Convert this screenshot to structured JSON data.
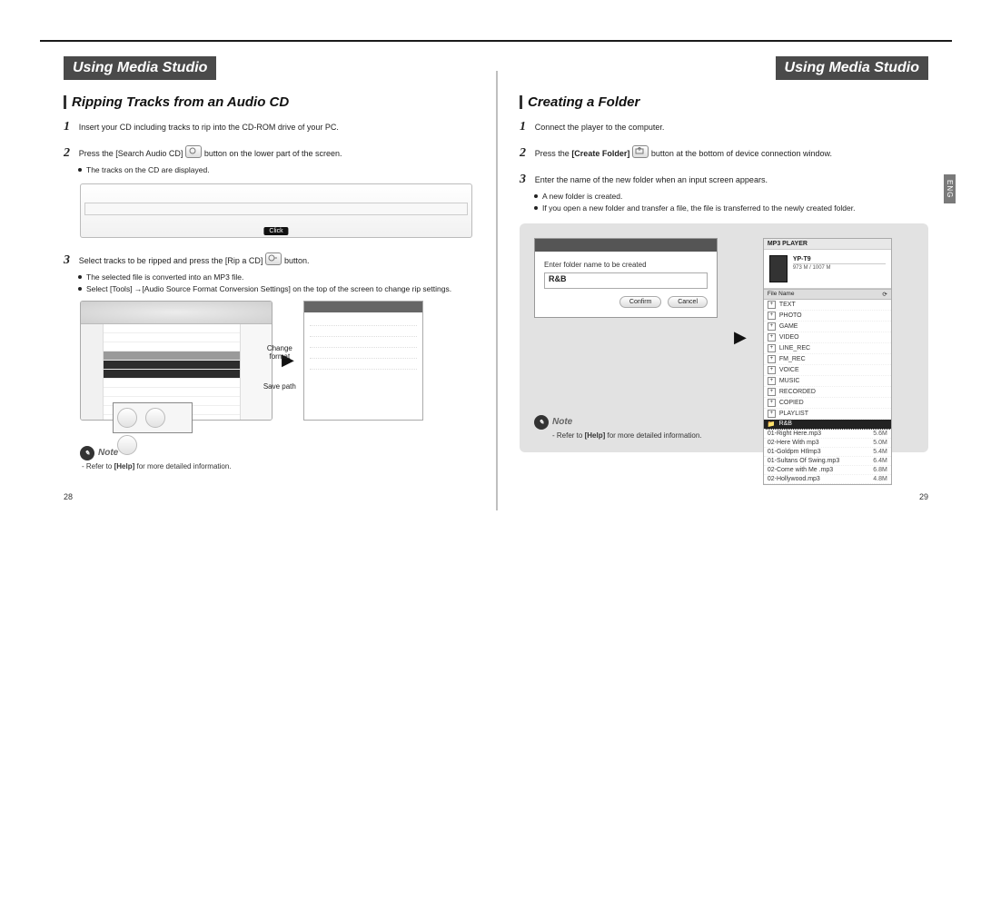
{
  "doc": {
    "lang_tab": "ENG",
    "header_title": "Using Media Studio",
    "left": {
      "page": "28",
      "subtitle": "Ripping Tracks from an Audio CD",
      "step1": "Insert your CD including tracks to rip into the CD-ROM drive of your PC.",
      "step2_pre": "Press the [Search Audio CD]",
      "step2_post": "button on the lower part of the screen.",
      "step2_b1": "The tracks on the CD are displayed.",
      "fig1_click": "Click",
      "step3_pre": "Select tracks to be ripped and press the [Rip a CD]",
      "step3_post": "button.",
      "step3_b1": "The selected file is converted into an MP3 file.",
      "step3_b2": "Select [Tools] →[Audio Source Format Conversion Settings] on the top of the screen to change rip settings.",
      "ann_change": "Change format",
      "ann_save": "Save path",
      "note_label": "Note",
      "note_text_pre": "- Refer to ",
      "note_text_bold": "[Help]",
      "note_text_post": " for more detailed information."
    },
    "right": {
      "page": "29",
      "subtitle": "Creating a Folder",
      "step1": "Connect the player to the computer.",
      "step2_pre": "Press the ",
      "step2_bold": "[Create Folder]",
      "step2_post": " button at the bottom of device connection window.",
      "step3": "Enter the name of the new folder when an input screen appears.",
      "step3_b1": "A new folder is created.",
      "step3_b2": "If you open a new folder and transfer a file, the file is transferred to the newly created folder.",
      "dialog": {
        "label": "Enter folder name to be created",
        "input": "R&B",
        "confirm": "Confirm",
        "cancel": "Cancel"
      },
      "tree": {
        "title": "MP3 PLAYER",
        "device": "YP-T9",
        "capacity": "973 M / 1007 M",
        "col_file": "File Name",
        "folders": [
          "TEXT",
          "PHOTO",
          "GAME",
          "VIDEO",
          "LINE_REC",
          "FM_REC",
          "VOICE",
          "MUSIC",
          "RECORDED",
          "COPIED",
          "PLAYLIST"
        ],
        "selected_folder": "R&B",
        "files": [
          {
            "n": "01-Right Here.mp3",
            "s": "5.6M"
          },
          {
            "n": "02-Here With mp3",
            "s": "5.0M"
          },
          {
            "n": "01-Goldpm HIlmp3",
            "s": "5.4M"
          },
          {
            "n": "01-Sultans Of Swing.mp3",
            "s": "6.4M"
          },
          {
            "n": "02-Come with Me .mp3",
            "s": "6.8M"
          },
          {
            "n": "02-Hollywood.mp3",
            "s": "4.8M"
          }
        ]
      },
      "note_label": "Note",
      "note_text_pre": "- Refer to ",
      "note_text_bold": "[Help]",
      "note_text_post": " for more detailed information."
    }
  }
}
